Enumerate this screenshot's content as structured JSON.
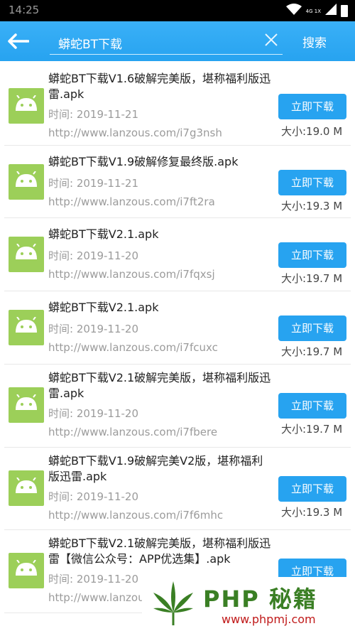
{
  "status_bar": {
    "time": "14:25",
    "network": "4G 1X"
  },
  "app_bar": {
    "back_icon": "arrow-left-icon",
    "search_query": "蟒蛇BT下载",
    "clear_icon": "close-icon",
    "search_label": "搜索"
  },
  "results": [
    {
      "title": "蟒蛇BT下载V1.6破解完美版，堪称福利版迅雷.apk",
      "time": "时间: 2019-11-21",
      "url": "http://www.lanzous.com/i7g3nsh",
      "size": "大小:19.0 M",
      "download": "立即下载"
    },
    {
      "title": "蟒蛇BT下载V1.9破解修复最终版.apk",
      "time": "时间: 2019-11-21",
      "url": "http://www.lanzous.com/i7ft2ra",
      "size": "大小:19.3 M",
      "download": "立即下载"
    },
    {
      "title": "蟒蛇BT下载V2.1.apk",
      "time": "时间: 2019-11-20",
      "url": "http://www.lanzous.com/i7fqxsj",
      "size": "大小:19.7 M",
      "download": "立即下载"
    },
    {
      "title": "蟒蛇BT下载V2.1.apk",
      "time": "时间: 2019-11-20",
      "url": "http://www.lanzous.com/i7fcuxc",
      "size": "大小:19.7 M",
      "download": "立即下载"
    },
    {
      "title": "蟒蛇BT下载V2.1破解完美版，堪称福利版迅雷.apk",
      "time": "时间: 2019-11-20",
      "url": "http://www.lanzous.com/i7fbere",
      "size": "大小:19.7 M",
      "download": "立即下载"
    },
    {
      "title": "蟒蛇BT下载V1.9破解完美V2版，堪称福利版迅雷.apk",
      "time": "时间: 2019-11-20",
      "url": "http://www.lanzous.com/i7f6mhc",
      "size": "大小:19.3 M",
      "download": "立即下载"
    },
    {
      "title": "蟒蛇BT下载V2.1破解完美版，堪称福利版迅雷【微信公众号：APP优选集】.apk",
      "time": "时间: 2019-11-20",
      "url": "http://www.lanzou",
      "size": "",
      "download": "立即下载"
    }
  ],
  "watermark": {
    "title": "PHP 秘籍",
    "url": "www.phpmj.com"
  },
  "colors": {
    "accent": "#27a3f0",
    "android_green": "#9ccf59"
  }
}
